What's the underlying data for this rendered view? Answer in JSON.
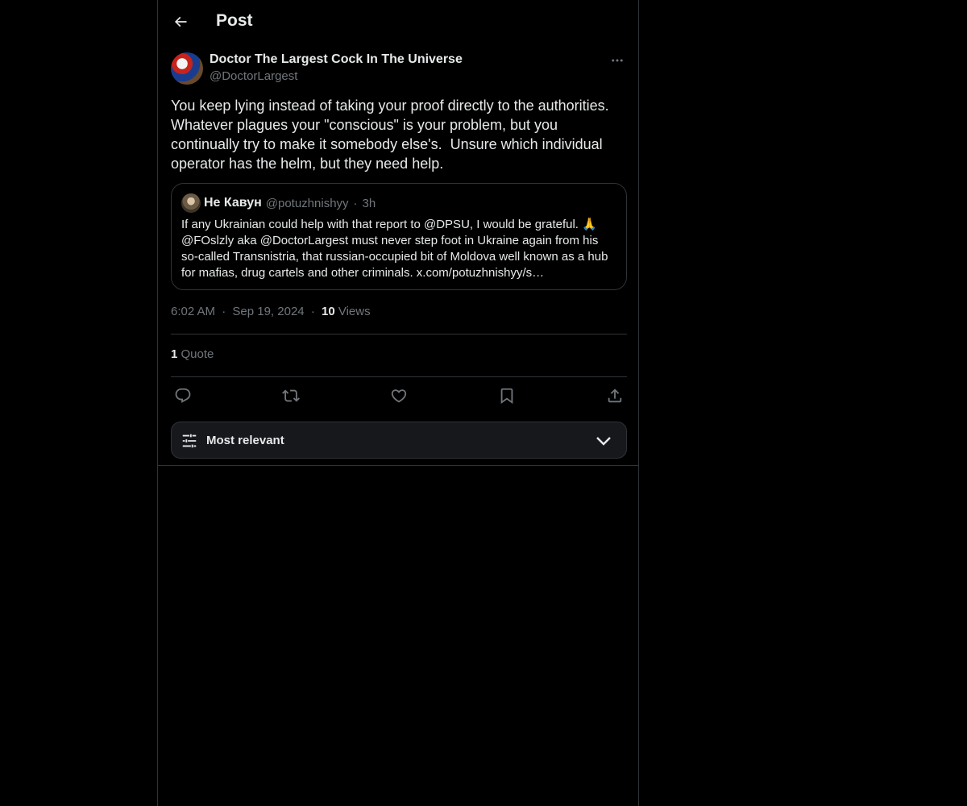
{
  "header": {
    "back_icon": "arrow-left-icon",
    "title": "Post"
  },
  "post": {
    "author": {
      "name": "Doctor The Largest Cock In The Universe",
      "handle": "@DoctorLargest"
    },
    "more_icon": "more-horizontal-icon",
    "text": "You keep lying instead of taking your proof directly to the authorities. Whatever plagues your \"conscious\" is your problem, but you continually try to make it somebody else's.  Unsure which individual operator has the helm, but they need help.",
    "quoted": {
      "name": "Не Кавун",
      "handle": "@potuzhnishyy",
      "separator": "·",
      "time": "3h",
      "text": "If any Ukrainian could help with that report to @DPSU, I would be grateful. 🙏 @FOslzly aka @DoctorLargest must never step foot in Ukraine again from his so-called Transnistria, that russian-occupied bit of Moldova well known as a hub for mafias, drug cartels and other criminals. x.com/potuzhnishyy/s…"
    },
    "meta": {
      "time": "6:02 AM",
      "separator": "·",
      "date": "Sep 19, 2024",
      "views_count": "10",
      "views_label": "Views"
    },
    "quotes": {
      "count": "1",
      "label": "Quote"
    },
    "actions": [
      "reply-icon",
      "repost-icon",
      "like-icon",
      "bookmark-icon",
      "share-icon"
    ]
  },
  "sort": {
    "icon": "sliders-icon",
    "label": "Most relevant",
    "chevron": "chevron-down-icon"
  },
  "colors": {
    "background": "#000000",
    "text": "#e7e9ea",
    "muted": "#71767b",
    "border": "#2f3336",
    "sort_bg": "#16181c"
  }
}
